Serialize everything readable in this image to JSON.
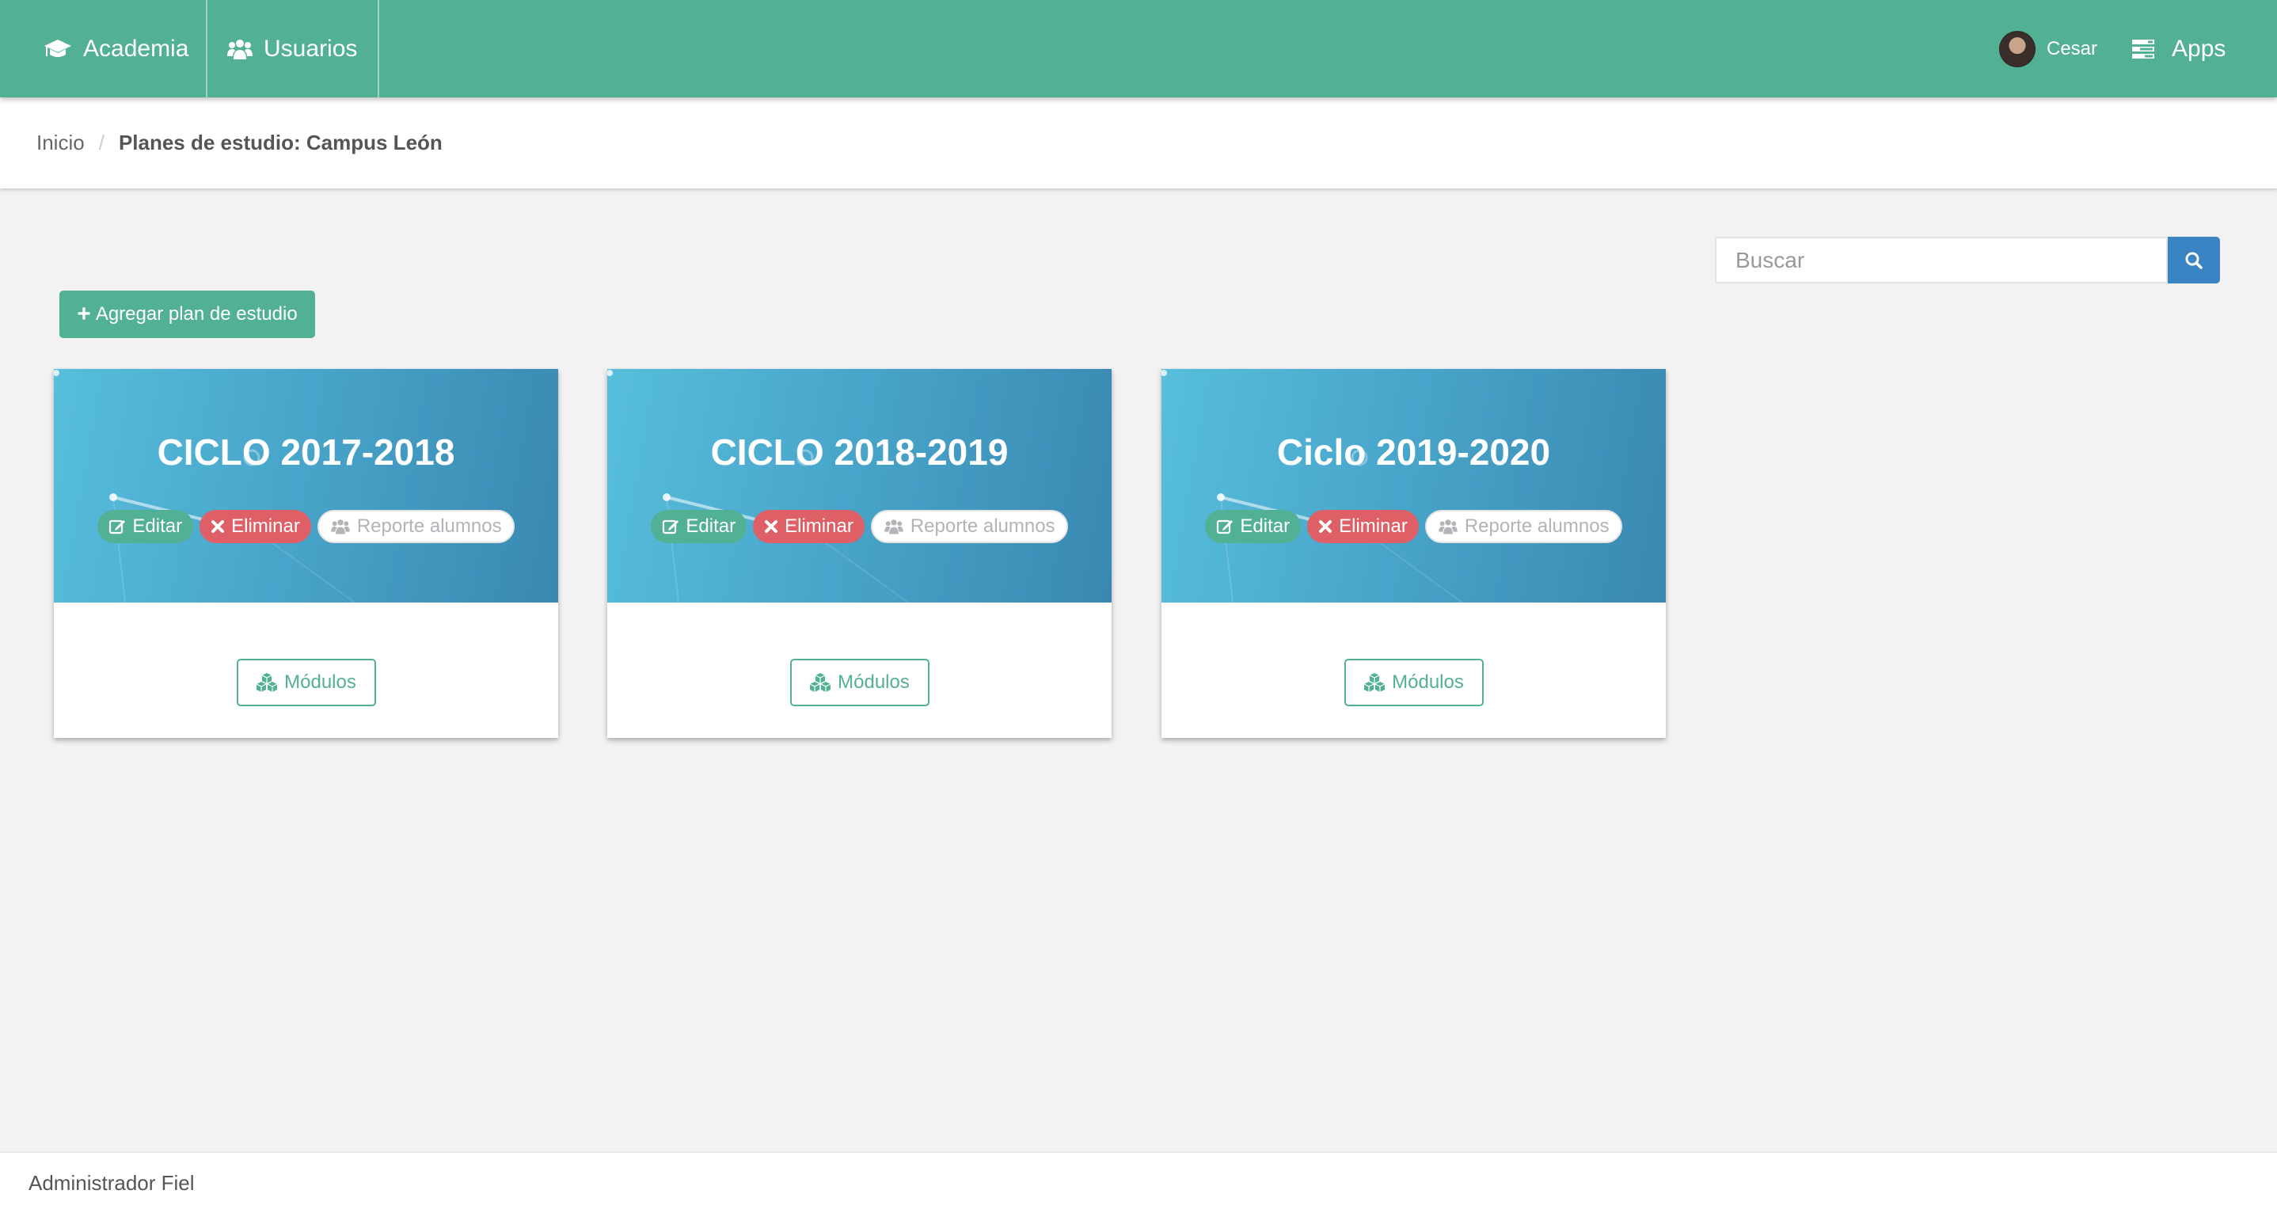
{
  "navbar": {
    "items": [
      {
        "label": "Academia",
        "icon": "graduation-cap-icon"
      },
      {
        "label": "Usuarios",
        "icon": "users-icon"
      }
    ],
    "user": {
      "name": "Cesar",
      "avatar": "user-avatar"
    },
    "apps_label": "Apps",
    "colors": {
      "navbar_bg": "#52b095"
    }
  },
  "breadcrumb": {
    "home": "Inicio",
    "separator": "/",
    "current": "Planes de estudio: Campus León"
  },
  "search": {
    "placeholder": "Buscar",
    "value": "",
    "button_icon": "search-icon"
  },
  "add_button": {
    "label": "Agregar plan de estudio",
    "icon": "plus-icon"
  },
  "cards": [
    {
      "title": "CICLO 2017-2018",
      "edit": "Editar",
      "delete": "Eliminar",
      "report": "Reporte alumnos",
      "modules": "Módulos"
    },
    {
      "title": "CICLO 2018-2019",
      "edit": "Editar",
      "delete": "Eliminar",
      "report": "Reporte alumnos",
      "modules": "Módulos"
    },
    {
      "title": "Ciclo 2019-2020",
      "edit": "Editar",
      "delete": "Eliminar",
      "report": "Reporte alumnos",
      "modules": "Módulos"
    }
  ],
  "footer": {
    "text": "Administrador Fiel"
  },
  "colors": {
    "primary_green": "#52b095",
    "danger_red": "#df5f67",
    "search_blue": "#3b84c4",
    "card_header_blue": "#49a6cb"
  }
}
